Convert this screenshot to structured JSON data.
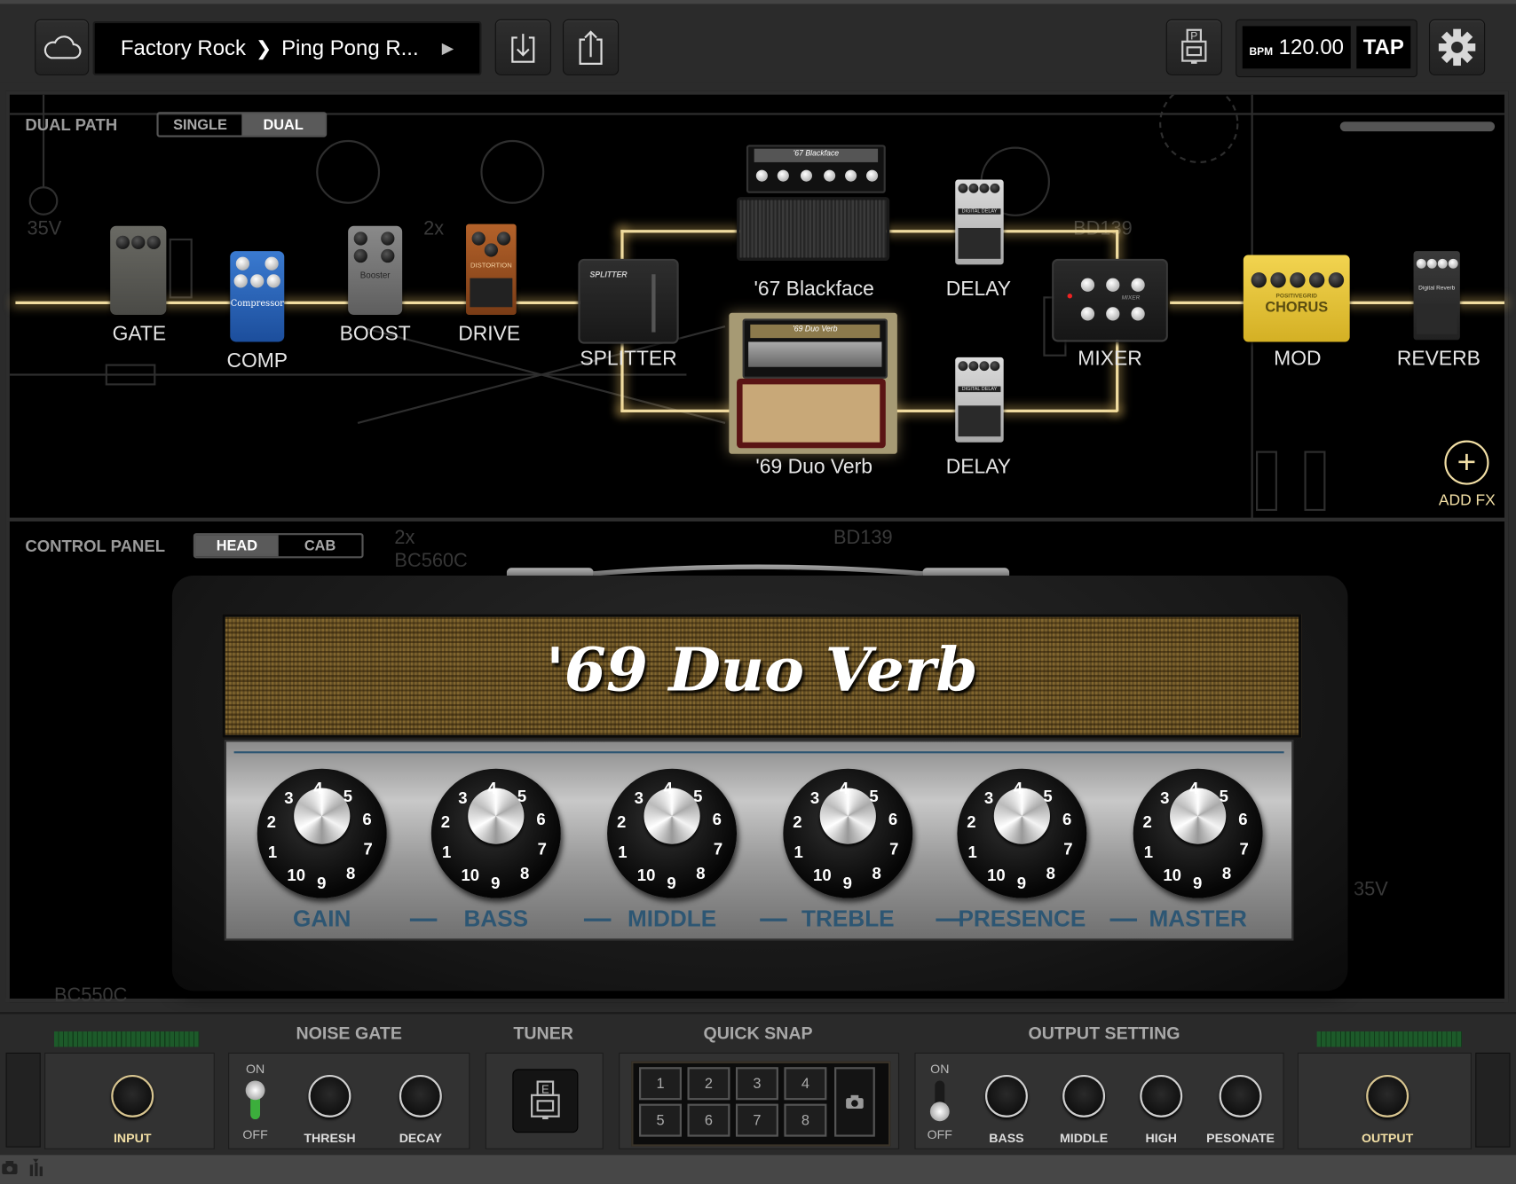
{
  "topbar": {
    "cloud_icon": "cloud-icon",
    "preset": {
      "bank": "Factory Rock",
      "separator": "❯",
      "name": "Ping Pong R...",
      "play_icon": "▶"
    },
    "import_icon": "download-tray-icon",
    "export_icon": "share-tray-icon",
    "pedalboard_icon": "pedal-p-icon",
    "bpm_label": "BPM",
    "bpm_value": "120.00",
    "tap_label": "TAP",
    "settings_icon": "gear-icon"
  },
  "signal_chain": {
    "mode_label": "DUAL PATH",
    "mode_options": [
      "SINGLE",
      "DUAL"
    ],
    "mode_selected": "DUAL",
    "scroll_position": 0,
    "modules": [
      {
        "id": "gate",
        "label": "GATE",
        "device": "Noise Gate"
      },
      {
        "id": "comp",
        "label": "COMP",
        "device": "Compressor"
      },
      {
        "id": "boost",
        "label": "BOOST",
        "device": "Booster"
      },
      {
        "id": "drive",
        "label": "DRIVE",
        "device": "Distortion"
      },
      {
        "id": "splitter",
        "label": "SPLITTER",
        "device": "Splitter"
      },
      {
        "id": "amp-a",
        "label": "'67 Blackface",
        "device": "'67 Blackface"
      },
      {
        "id": "delay-a",
        "label": "DELAY",
        "device": "Digital Delay"
      },
      {
        "id": "amp-b",
        "label": "'69 Duo Verb",
        "device": "'69 Duo Verb",
        "selected": true
      },
      {
        "id": "delay-b",
        "label": "DELAY",
        "device": "Digital Delay"
      },
      {
        "id": "mixer",
        "label": "MIXER",
        "device": "Mixer"
      },
      {
        "id": "mod",
        "label": "MOD",
        "device": "Chorus"
      },
      {
        "id": "reverb",
        "label": "REVERB",
        "device": "Digital Reverb"
      }
    ],
    "pedal_text": {
      "comp": "Compressor",
      "boost": "Booster",
      "drive": "DISTORTION",
      "splitter": "SPLITTER",
      "amp_a": "'67 Blackface",
      "amp_b": "'69 Duo Verb",
      "delay": "DIGITAL DELAY",
      "brand": "POSITIVEGRID",
      "mixer": "MIXER",
      "chorus_brand": "POSITIVEGRID",
      "chorus": "CHORUS",
      "reverb": "Digital Reverb"
    },
    "add_fx_label": "ADD FX"
  },
  "control_panel": {
    "label": "CONTROL PANEL",
    "tabs": [
      "HEAD",
      "CAB"
    ],
    "tab_selected": "HEAD",
    "amp_name": "'69 Duo Verb",
    "knobs": [
      {
        "label": "GAIN",
        "dial_numbers": [
          "1",
          "2",
          "3",
          "4",
          "5",
          "6",
          "7",
          "8",
          "9",
          "10"
        ]
      },
      {
        "label": "BASS",
        "dial_numbers": [
          "1",
          "2",
          "3",
          "4",
          "5",
          "6",
          "7",
          "8",
          "9",
          "10"
        ]
      },
      {
        "label": "MIDDLE",
        "dial_numbers": [
          "1",
          "2",
          "3",
          "4",
          "5",
          "6",
          "7",
          "8",
          "9",
          "10"
        ]
      },
      {
        "label": "TREBLE",
        "dial_numbers": [
          "1",
          "2",
          "3",
          "4",
          "5",
          "6",
          "7",
          "8",
          "9",
          "10"
        ]
      },
      {
        "label": "PRESENCE",
        "dial_numbers": [
          "1",
          "2",
          "3",
          "4",
          "5",
          "6",
          "7",
          "8",
          "9",
          "10"
        ]
      },
      {
        "label": "MASTER",
        "dial_numbers": [
          "1",
          "2",
          "3",
          "4",
          "5",
          "6",
          "7",
          "8",
          "9",
          "10"
        ]
      }
    ]
  },
  "bottom_bar": {
    "input": {
      "label": "INPUT"
    },
    "noise_gate": {
      "title": "NOISE GATE",
      "switch_on": "ON",
      "switch_off": "OFF",
      "state": "ON",
      "knobs": [
        "THRESH",
        "DECAY"
      ]
    },
    "tuner": {
      "title": "TUNER",
      "icon": "tuner-e-icon"
    },
    "quick_snap": {
      "title": "QUICK SNAP",
      "slots": [
        "1",
        "2",
        "3",
        "4",
        "5",
        "6",
        "7",
        "8"
      ],
      "camera_icon": "camera-icon"
    },
    "output_setting": {
      "title": "OUTPUT SETTING",
      "switch_on": "ON",
      "switch_off": "OFF",
      "state": "OFF",
      "knobs": [
        "BASS",
        "MIDDLE",
        "HIGH",
        "PESONATE"
      ]
    },
    "output": {
      "label": "OUTPUT"
    }
  },
  "status_bar": {
    "icons": [
      "camera-icon",
      "mixer-sliders-icon"
    ]
  },
  "colors": {
    "accent_gold": "#f0dca0",
    "label_gold": "#f2dfa5",
    "amp_label_blue": "#2d5673",
    "meter_green": "#1d5a2a",
    "switch_green": "#3cae3c"
  }
}
